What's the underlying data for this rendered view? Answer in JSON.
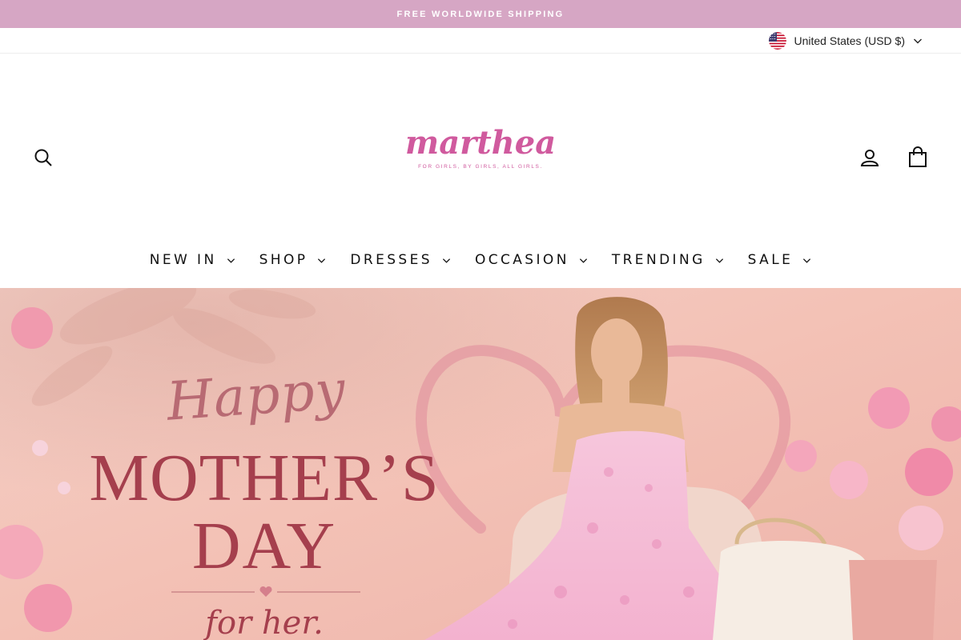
{
  "announcement": {
    "text": "FREE WORLDWIDE SHIPPING"
  },
  "currency": {
    "label": "United States (USD $)",
    "flag_icon": "us-flag-icon"
  },
  "brand": {
    "name": "marthea",
    "tagline": "FOR GIRLS, BY GIRLS, ALL GIRLS.",
    "color": "#d05a9e"
  },
  "header_icons": {
    "search": "search-icon",
    "account": "user-icon",
    "cart": "shopping-bag-icon"
  },
  "nav": {
    "items": [
      {
        "label": "NEW IN"
      },
      {
        "label": "SHOP"
      },
      {
        "label": "DRESSES"
      },
      {
        "label": "OCCASION"
      },
      {
        "label": "TRENDING"
      },
      {
        "label": "SALE"
      }
    ]
  },
  "hero": {
    "script_word": "Happy",
    "headline_line1": "MOTHER’S",
    "headline_line2": "DAY",
    "subline": "for her.",
    "background_color": "#f3c2b8",
    "text_color": "#a53f4d"
  },
  "colors": {
    "announcement_bg": "#d6a6c4",
    "accent": "#d05a9e"
  }
}
